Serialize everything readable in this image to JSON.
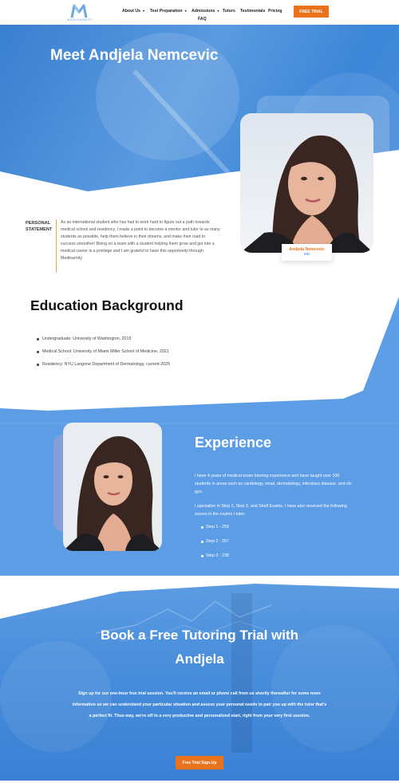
{
  "nav": {
    "logo_text": "MEDLEARNITY",
    "items": [
      {
        "label": "About Us",
        "dropdown": true
      },
      {
        "label": "Test Preparation",
        "dropdown": true
      },
      {
        "label": "Admissions",
        "dropdown": true
      },
      {
        "label": "Tutors",
        "dropdown": false
      },
      {
        "label": "Testimonials",
        "dropdown": false
      },
      {
        "label": "Pricing",
        "dropdown": false
      },
      {
        "label": "FAQ",
        "dropdown": false
      }
    ],
    "cta_label": "FREE TRIAL"
  },
  "hero": {
    "title": "Meet Andjela Nemcevic",
    "tutor_name": "Andjela Nemcevic",
    "tutor_credential": "MD"
  },
  "statement": {
    "label_line1": "PERSONAL",
    "label_line2": "STATEMENT",
    "text": "As an international student who has had to work hard to figure out a path towards medical school and residency, I made a point to become a mentor and tutor to as many students as possible, help them believe in their dreams, and make their road to success smoother! Being on a team with a student helping them grow and get into a medical career is a privilege and I am grateful to have this opportunity through Medlearnity"
  },
  "education": {
    "title": "Education Background",
    "items": [
      "Undergraduate: University of Washington, 2015",
      "Medical School: University of Miami Miller School of Medicine, 2021",
      "Residency: NYU Langone Department of Dermatology, current-2025"
    ]
  },
  "experience": {
    "title": "Experience",
    "paragraph1": "I have 4 years of medical exam tutoring experience and have taught over 100 students in areas such as cardiology, renal, dermatology, infectious disease, and ob-gyn.",
    "paragraph2": "I specialize in Step 2, Step 3, and Shelf Exams. I have also received the following scores in the exams I tutor:",
    "scores": [
      "Step 1 - 259",
      "Step 2 - 267",
      "Step 3 - 238"
    ]
  },
  "cta": {
    "title_line1": "Book a Free Tutoring Trial with",
    "title_line2": "Andjela",
    "text": "Sign up for our one-hour free trial session. You'll receive an email or phone call from us shortly thereafter for some more information so we can understand your particular situation and assess your personal needs to pair you up with the tutor that's a perfect fit. Thus way, we're off to a very productive and personalized start, right from your very first session.",
    "button_label": "Free Trial Sign-Up"
  },
  "colors": {
    "accent_orange": "#e8731c",
    "brand_blue": "#3b86d8",
    "light_blue": "#5c9de6"
  }
}
